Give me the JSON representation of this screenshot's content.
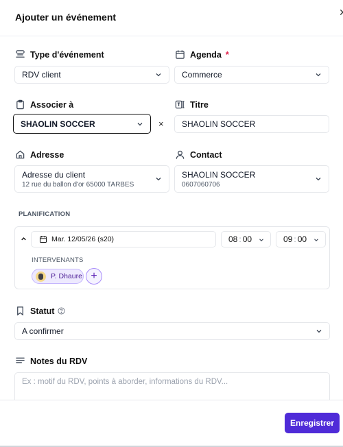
{
  "header": {
    "title": "Ajouter un événement",
    "close_icon": "close-icon"
  },
  "type_evenement": {
    "label": "Type d'événement",
    "value": "RDV client",
    "icon": "layers-icon"
  },
  "agenda": {
    "label": "Agenda",
    "required_mark": "*",
    "value": "Commerce",
    "icon": "calendar-icon"
  },
  "associer": {
    "label": "Associer à",
    "value": "SHAOLIN SOCCER",
    "clear": "×",
    "icon": "clipboard-icon"
  },
  "titre": {
    "label": "Titre",
    "value": "SHAOLIN SOCCER",
    "icon": "text-cursor-icon"
  },
  "adresse": {
    "label": "Adresse",
    "value": "Adresse du client",
    "sub": "12 rue du ballon d'or 65000 TARBES",
    "icon": "home-icon"
  },
  "contact": {
    "label": "Contact",
    "value": "SHAOLIN SOCCER",
    "sub": "0607060706",
    "icon": "user-icon"
  },
  "planification": {
    "title": "PLANIFICATION",
    "date": "Mar. 12/05/26 (s20)",
    "start": {
      "hour": "08",
      "min": "00"
    },
    "end": {
      "hour": "09",
      "min": "00"
    },
    "separator": ":",
    "intervenants_title": "INTERVENANTS",
    "intervenant": "P. Dhaure",
    "add_label": "+"
  },
  "statut": {
    "label": "Statut",
    "value": "A confirmer",
    "icon": "bookmark-icon"
  },
  "notes": {
    "label": "Notes du RDV",
    "placeholder": "Ex : motif du RDV, points à aborder, informations du RDV...",
    "icon": "lines-icon"
  },
  "footer": {
    "save_label": "Enregistrer"
  },
  "colors": {
    "accent": "#4f2bd8",
    "required": "#e11d48",
    "chip_bg": "#ede9fe"
  }
}
